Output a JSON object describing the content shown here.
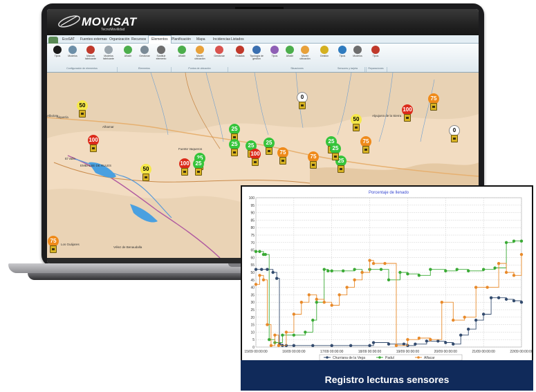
{
  "app": {
    "brand": "MOVISAT",
    "brand_sub": "TecnoMovilidad"
  },
  "ribbon": {
    "tabs": [
      "EcoSAT",
      "Fuentes externas",
      "Organización",
      "Recursos",
      "Elementos",
      "Planificación",
      "Mapa",
      "Incidencias",
      "Listados"
    ],
    "active_tab": "Elementos",
    "buttons": [
      {
        "label": "Tipos",
        "color": "#1a1a1a"
      },
      {
        "label": "Modelos",
        "color": "#6c8fa8"
      },
      {
        "label": "Marcas fabricante",
        "color": "#c0392b"
      },
      {
        "label": "Modelos fabricante",
        "color": "#9aa5ad"
      },
      {
        "label": "Añadir",
        "color": "#4cae4c"
      },
      {
        "label": "Gestionar",
        "color": "#7a8a96"
      },
      {
        "label": "Sustituir elemento",
        "color": "#6d6d6d"
      },
      {
        "label": "Añadir",
        "color": "#4cae4c"
      },
      {
        "label": "Mover ubicación",
        "color": "#e8a13a"
      },
      {
        "label": "Gestionar",
        "color": "#d9534f"
      },
      {
        "label": "Estados",
        "color": "#c0392b"
      },
      {
        "label": "Tipología de gestión",
        "color": "#3a6fb0"
      },
      {
        "label": "Tipos",
        "color": "#8e5fb5"
      },
      {
        "label": "Añadir",
        "color": "#4cae4c"
      },
      {
        "label": "Mover ubicación",
        "color": "#e8a13a"
      },
      {
        "label": "Gestión",
        "color": "#d4b020"
      },
      {
        "label": "Tipos",
        "color": "#2f7bbf"
      },
      {
        "label": "Modelos",
        "color": "#6d6d6d"
      },
      {
        "label": "Tipos",
        "color": "#c0392b"
      }
    ],
    "groups": [
      "Configuración de elementos",
      "Elementos",
      "Puntos de ubicación",
      "Situaciones",
      "Sensores y tarjeta",
      "Reparaciones"
    ]
  },
  "map": {
    "places": [
      "Albolote",
      "Alquería",
      "Alhamar",
      "Fuente Vaqueros",
      "El Valle",
      "Alpujarra de la Sierra",
      "Los Guájares",
      "Vélez de Benaudalla",
      "EMBALSE DE RULES"
    ],
    "markers": [
      {
        "value": "50",
        "style": "y"
      },
      {
        "value": "0",
        "style": "w"
      },
      {
        "value": "100",
        "style": "r"
      },
      {
        "value": "75",
        "style": "o"
      },
      {
        "value": "100",
        "style": "r"
      },
      {
        "value": "50",
        "style": "y"
      },
      {
        "value": "0",
        "style": "w"
      },
      {
        "value": "25",
        "style": "g"
      },
      {
        "value": "25",
        "style": "g"
      },
      {
        "value": "25",
        "style": "g"
      },
      {
        "value": "100",
        "style": "r"
      },
      {
        "value": "25",
        "style": "g"
      },
      {
        "value": "75",
        "style": "o"
      },
      {
        "value": "75",
        "style": "o"
      },
      {
        "value": "25",
        "style": "g"
      },
      {
        "value": "25",
        "style": "g"
      },
      {
        "value": "100",
        "style": "r"
      },
      {
        "value": "25",
        "style": "g"
      },
      {
        "value": "50",
        "style": "y"
      },
      {
        "value": "25",
        "style": "g"
      },
      {
        "value": "25",
        "style": "g"
      },
      {
        "value": "75",
        "style": "o"
      },
      {
        "value": "75",
        "style": "o"
      }
    ]
  },
  "chart_data": {
    "type": "line",
    "title": "Porcentaje de llenado",
    "ylim": [
      0,
      100
    ],
    "y_ticks": [
      0,
      5,
      10,
      15,
      20,
      25,
      30,
      35,
      40,
      45,
      50,
      55,
      60,
      65,
      70,
      75,
      80,
      85,
      90,
      95,
      100
    ],
    "x_ticks": [
      "15/09 00:00:00",
      "16/09 00:00:00",
      "17/09 00:00:00",
      "18/09 00:00:00",
      "19/09 00:00:00",
      "20/09 00:00:00",
      "21/09 00:00:00",
      "22/09 00:00:00"
    ],
    "xlim": [
      0,
      7
    ],
    "grid": true,
    "legend_position": "bottom",
    "series": [
      {
        "name": "Churriana de la Vega",
        "color": "#334b6e",
        "x": [
          0.0,
          0.15,
          0.3,
          0.45,
          0.55,
          0.62,
          0.7,
          0.8,
          1.0,
          1.5,
          2.0,
          2.5,
          3.0,
          3.1,
          3.5,
          3.9,
          4.0,
          4.2,
          4.5,
          4.8,
          5.0,
          5.2,
          5.4,
          5.6,
          5.8,
          6.0,
          6.2,
          6.4,
          6.6,
          6.8,
          7.0
        ],
        "values": [
          52,
          52,
          52,
          50,
          46,
          2,
          1,
          1,
          1,
          1,
          1,
          1,
          1,
          3,
          2,
          2,
          1,
          2,
          4,
          4,
          3,
          2,
          8,
          12,
          18,
          22,
          33,
          33,
          32,
          31,
          30
        ]
      },
      {
        "name": "Padul",
        "color": "#3aaa35",
        "x": [
          0.0,
          0.1,
          0.2,
          0.25,
          0.35,
          0.5,
          0.7,
          1.0,
          1.3,
          1.5,
          1.6,
          1.8,
          1.9,
          2.0,
          2.3,
          2.6,
          2.8,
          3.0,
          3.3,
          3.5,
          3.8,
          4.0,
          4.3,
          4.6,
          5.0,
          5.3,
          5.6,
          6.0,
          6.3,
          6.6,
          6.8,
          7.0
        ],
        "values": [
          64,
          64,
          62,
          62,
          5,
          3,
          8,
          8,
          10,
          18,
          30,
          52,
          51,
          51,
          51,
          52,
          50,
          52,
          52,
          45,
          50,
          49,
          48,
          52,
          51,
          52,
          51,
          52,
          53,
          70,
          71,
          71
        ]
      },
      {
        "name": "Alfacar",
        "color": "#e88a2a",
        "x": [
          0.0,
          0.1,
          0.2,
          0.3,
          0.4,
          0.5,
          0.6,
          0.8,
          1.0,
          1.2,
          1.4,
          1.6,
          1.8,
          2.0,
          2.2,
          2.4,
          2.6,
          2.8,
          3.0,
          3.1,
          3.4,
          3.7,
          4.0,
          4.3,
          4.6,
          4.9,
          5.2,
          5.5,
          5.8,
          6.1,
          6.4,
          6.6,
          6.8,
          7.0
        ],
        "values": [
          42,
          48,
          45,
          15,
          1,
          8,
          1,
          10,
          22,
          30,
          35,
          32,
          30,
          28,
          35,
          40,
          45,
          50,
          58,
          56,
          56,
          1,
          5,
          6,
          5,
          30,
          18,
          20,
          40,
          40,
          56,
          50,
          48,
          62
        ]
      }
    ]
  },
  "caption": "Registro lecturas sensores"
}
